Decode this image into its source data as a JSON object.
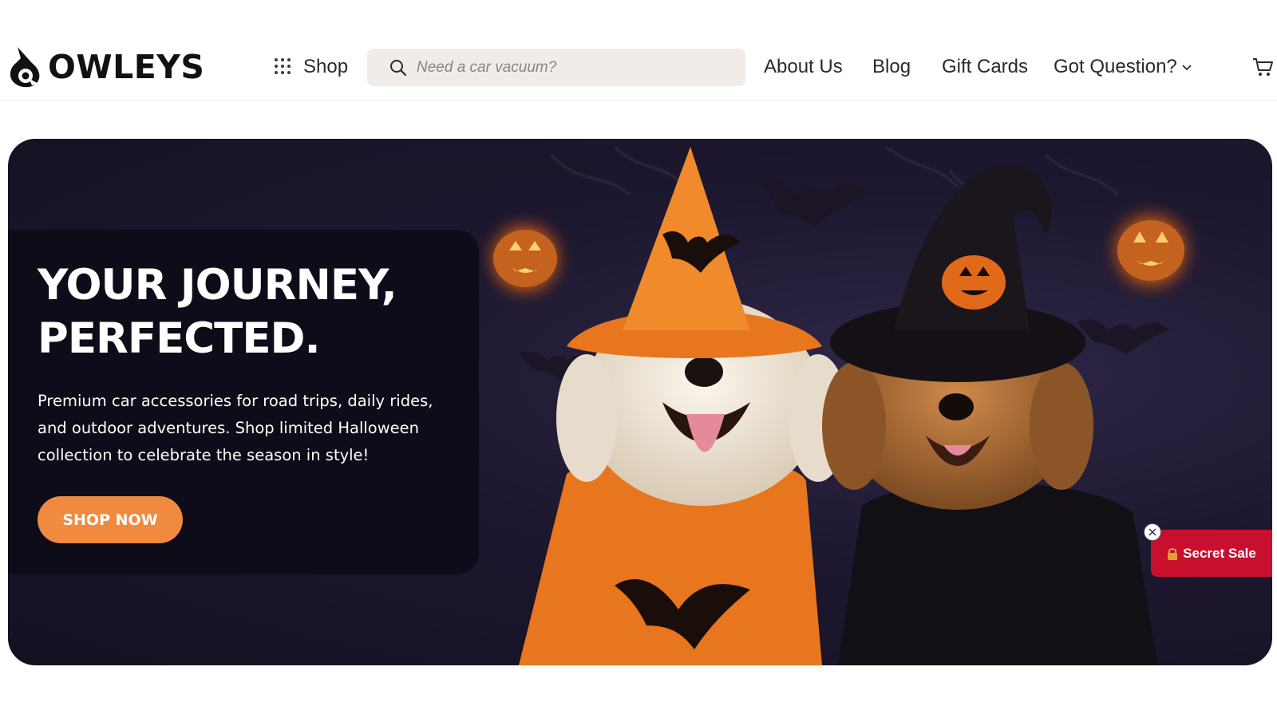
{
  "header": {
    "logo_text": "OWLEYS",
    "shop_label": "Shop",
    "search": {
      "placeholder": "Need a car vacuum?"
    },
    "nav": {
      "about": "About Us",
      "blog": "Blog",
      "gift_cards": "Gift Cards",
      "question": "Got Question?"
    }
  },
  "hero": {
    "title_line1": "YOUR JOURNEY,",
    "title_line2": "PERFECTED.",
    "subtitle": "Premium car accessories for road trips, daily rides, and outdoor adventures. Shop limited Halloween collection to celebrate the season in style!",
    "cta_label": "SHOP NOW"
  },
  "promo": {
    "secret_sale_label": "Secret Sale"
  },
  "colors": {
    "accent_orange": "#f08a3e",
    "promo_red": "#c8102e",
    "hero_bg": "#1d1830",
    "search_bg": "#f1ece7"
  },
  "icons": [
    "logo-mark-icon",
    "grid-icon",
    "search-icon",
    "chevron-down-icon",
    "cart-icon",
    "close-icon",
    "lock-icon"
  ]
}
